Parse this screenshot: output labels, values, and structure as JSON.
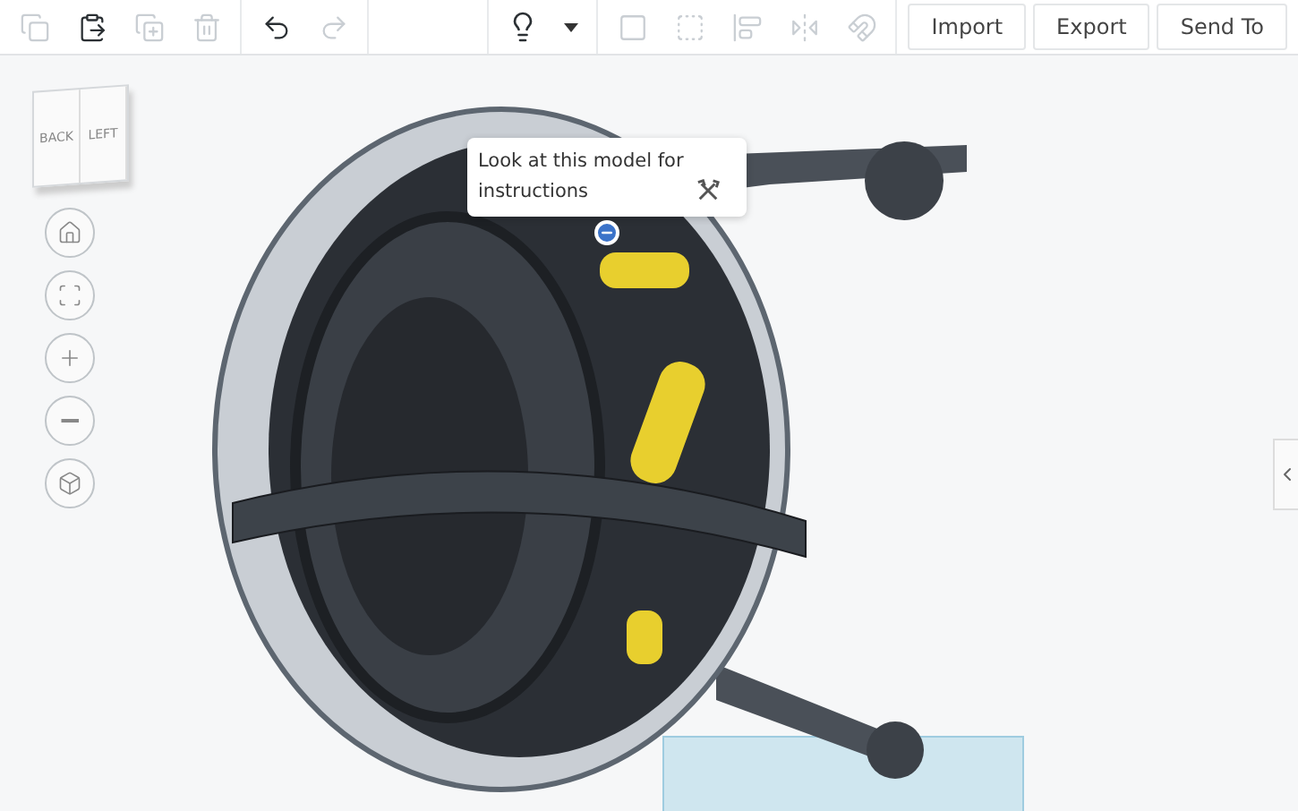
{
  "toolbar": {
    "edit_tools": [
      {
        "kind": "copy",
        "disabled": true
      },
      {
        "kind": "paste",
        "disabled": false
      },
      {
        "kind": "duplicate",
        "disabled": true
      },
      {
        "kind": "delete",
        "disabled": true
      }
    ],
    "history_tools": [
      {
        "kind": "undo",
        "disabled": false
      },
      {
        "kind": "redo",
        "disabled": true
      }
    ],
    "shape_tools": [
      {
        "kind": "group",
        "disabled": true
      },
      {
        "kind": "ungroup",
        "disabled": true
      },
      {
        "kind": "align",
        "disabled": true
      },
      {
        "kind": "mirror",
        "disabled": true
      },
      {
        "kind": "magnet",
        "disabled": true
      }
    ],
    "buttons": [
      "Import",
      "Export",
      "Send To"
    ]
  },
  "view_cube": {
    "faces": [
      "BACK",
      "LEFT"
    ]
  },
  "nav_buttons": [
    {
      "kind": "home"
    },
    {
      "kind": "fit"
    },
    {
      "kind": "zoom-in"
    },
    {
      "kind": "zoom-out"
    },
    {
      "kind": "perspective"
    }
  ],
  "tooltip": {
    "text": "Look at this model for instructions"
  }
}
